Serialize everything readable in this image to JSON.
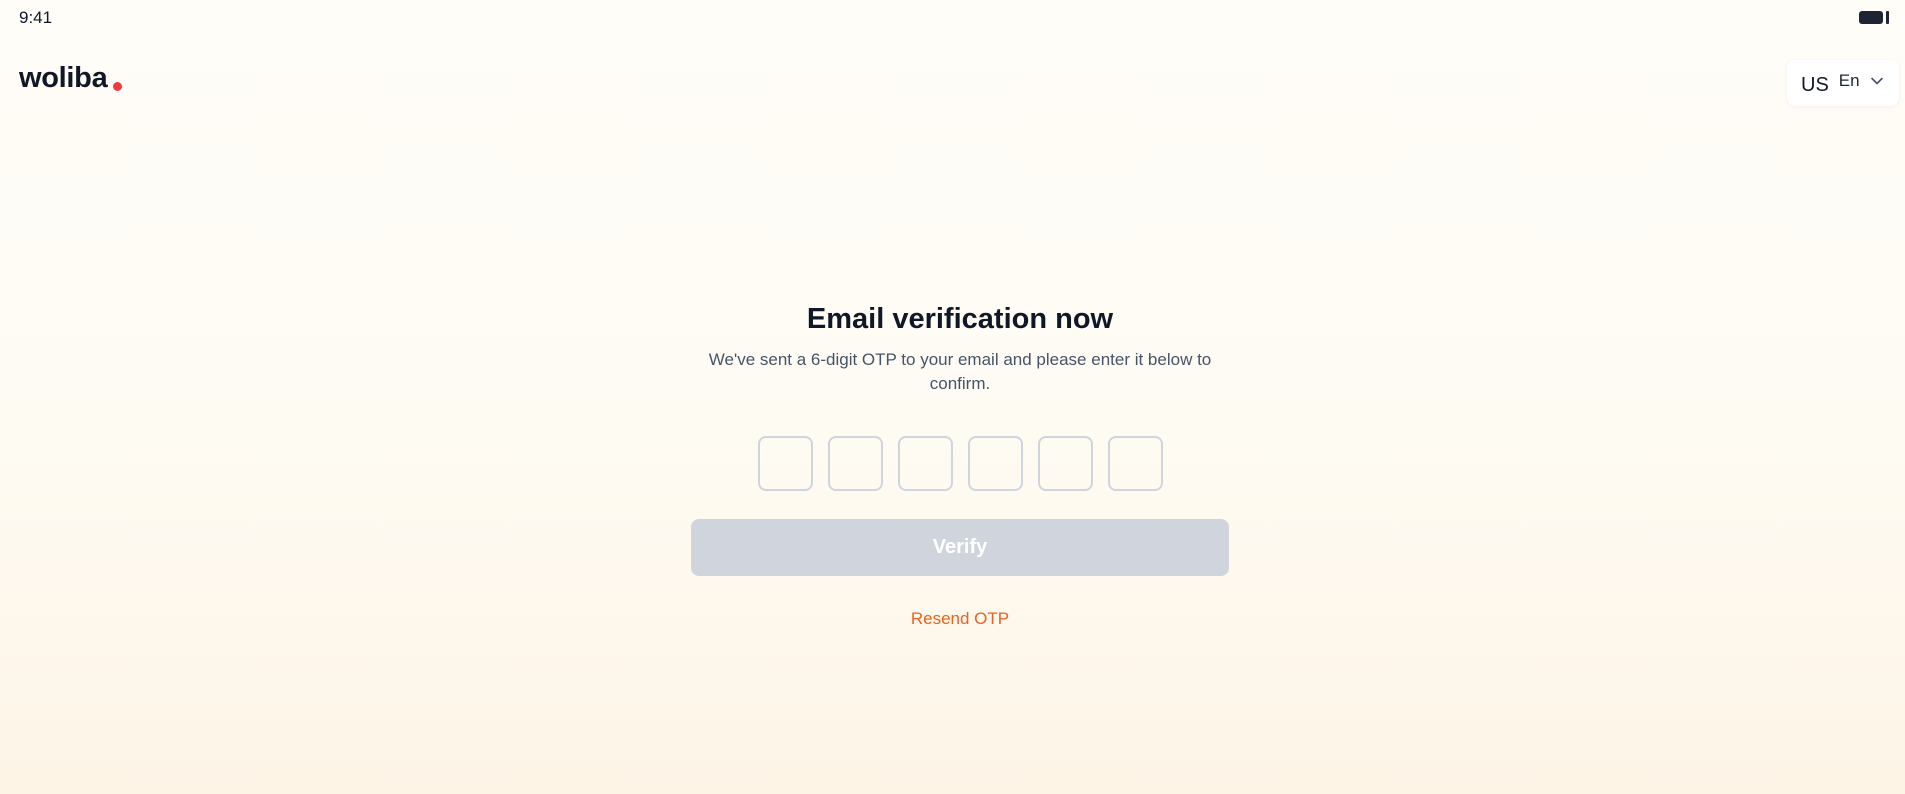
{
  "status_bar": {
    "time": "9:41"
  },
  "header": {
    "logo_text": "woliba",
    "language": {
      "flag": "US",
      "code": "En",
      "icon": "chevron-down-icon"
    }
  },
  "verification": {
    "title": "Email verification now",
    "subtitle": "We've sent a 6-digit OTP to your email and please enter it below to confirm.",
    "otp_digits": [
      "",
      "",
      "",
      "",
      "",
      ""
    ],
    "verify_label": "Verify",
    "resend_label": "Resend OTP"
  },
  "colors": {
    "brand_dot": "#ef3b3b",
    "link": "#e8631c",
    "button_disabled": "#d0d5dd",
    "text_primary": "#101828"
  }
}
